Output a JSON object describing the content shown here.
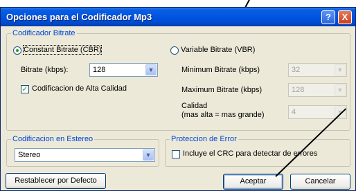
{
  "window": {
    "title": "Opciones para el Codificador Mp3",
    "help_glyph": "?",
    "close_glyph": "X"
  },
  "bitrate_group": {
    "legend": "Codificador Bitrate",
    "cbr": {
      "label": "Constant Bitrate (CBR)",
      "selected": true
    },
    "vbr": {
      "label": "Variable Bitrate (VBR)",
      "selected": false
    },
    "bitrate_label": "Bitrate (kbps):",
    "bitrate_value": "128",
    "hq_label": "Codificacion de Alta Calidad",
    "hq_checked": true,
    "min_label": "Minimum Bitrate (kbps)",
    "min_value": "32",
    "max_label": "Maximum Bitrate (kbps)",
    "max_value": "128",
    "quality_label_line1": "Calidad",
    "quality_label_line2": "(mas alta = mas grande)",
    "quality_value": "4"
  },
  "stereo_group": {
    "legend": "Codificacion en Estereo",
    "value": "Stereo"
  },
  "error_group": {
    "legend": "Proteccion de Error",
    "crc_label": "Incluye el CRC para detectar de errores",
    "crc_checked": false
  },
  "buttons": {
    "reset": "Restablecer por Defecto",
    "ok": "Aceptar",
    "cancel": "Cancelar"
  },
  "icons": {
    "dropdown": "chevron-down-icon",
    "check": "checkmark-icon"
  }
}
